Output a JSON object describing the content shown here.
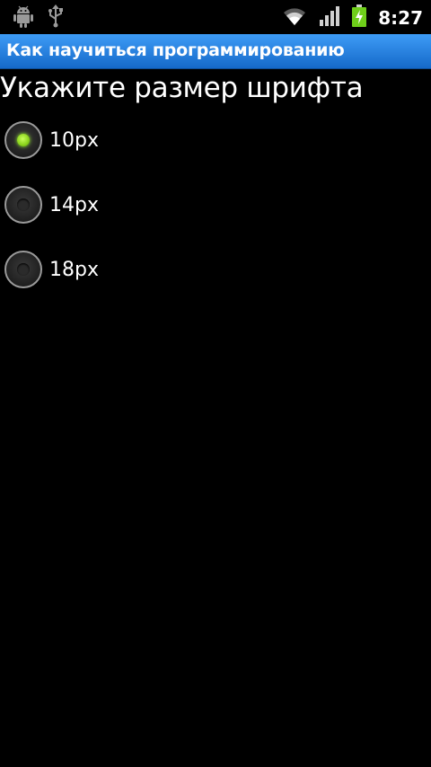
{
  "status_bar": {
    "time": "8:27",
    "left_icons": [
      "android-icon",
      "usb-icon"
    ],
    "right_icons": [
      "wifi-icon",
      "signal-icon",
      "battery-charging-icon"
    ]
  },
  "app": {
    "title": "Как научиться программированию"
  },
  "main": {
    "prompt": "Укажите размер шрифта",
    "options": [
      {
        "label": "10px",
        "selected": true
      },
      {
        "label": "14px",
        "selected": false
      },
      {
        "label": "18px",
        "selected": false
      }
    ]
  },
  "colors": {
    "title_bar": "#2a86e6",
    "radio_selected": "#8ad21c",
    "background": "#000000"
  }
}
